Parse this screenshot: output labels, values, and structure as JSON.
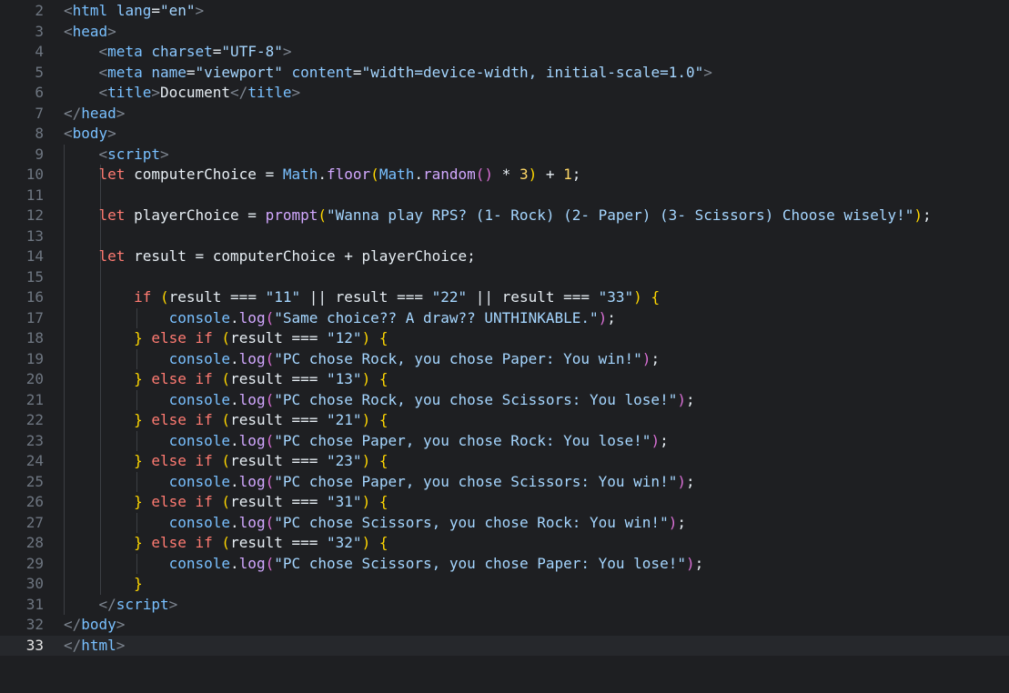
{
  "editor": {
    "current_line": 33,
    "lines": [
      {
        "n": "2",
        "tokens": [
          [
            "punct",
            "<"
          ],
          [
            "tag",
            "html"
          ],
          [
            "txt",
            " "
          ],
          [
            "attr",
            "lang"
          ],
          [
            "op",
            "="
          ],
          [
            "str",
            "\"en\""
          ],
          [
            "punct",
            ">"
          ]
        ]
      },
      {
        "n": "3",
        "tokens": [
          [
            "punct",
            "<"
          ],
          [
            "tag",
            "head"
          ],
          [
            "punct",
            ">"
          ]
        ]
      },
      {
        "n": "4",
        "tokens": [
          [
            "txt",
            "    "
          ],
          [
            "punct",
            "<"
          ],
          [
            "tag",
            "meta"
          ],
          [
            "txt",
            " "
          ],
          [
            "attr",
            "charset"
          ],
          [
            "op",
            "="
          ],
          [
            "str",
            "\"UTF-8\""
          ],
          [
            "punct",
            ">"
          ]
        ]
      },
      {
        "n": "5",
        "tokens": [
          [
            "txt",
            "    "
          ],
          [
            "punct",
            "<"
          ],
          [
            "tag",
            "meta"
          ],
          [
            "txt",
            " "
          ],
          [
            "attr",
            "name"
          ],
          [
            "op",
            "="
          ],
          [
            "str",
            "\"viewport\""
          ],
          [
            "txt",
            " "
          ],
          [
            "attr",
            "content"
          ],
          [
            "op",
            "="
          ],
          [
            "str",
            "\"width=device-width, initial-scale=1.0\""
          ],
          [
            "punct",
            ">"
          ]
        ]
      },
      {
        "n": "6",
        "tokens": [
          [
            "txt",
            "    "
          ],
          [
            "punct",
            "<"
          ],
          [
            "tag",
            "title"
          ],
          [
            "punct",
            ">"
          ],
          [
            "txt",
            "Document"
          ],
          [
            "punct",
            "</"
          ],
          [
            "tag",
            "title"
          ],
          [
            "punct",
            ">"
          ]
        ]
      },
      {
        "n": "7",
        "tokens": [
          [
            "punct",
            "</"
          ],
          [
            "tag",
            "head"
          ],
          [
            "punct",
            ">"
          ]
        ]
      },
      {
        "n": "8",
        "tokens": [
          [
            "punct",
            "<"
          ],
          [
            "tag",
            "body"
          ],
          [
            "punct",
            ">"
          ]
        ]
      },
      {
        "n": "9",
        "tokens": [
          [
            "txt",
            "    "
          ],
          [
            "punct",
            "<"
          ],
          [
            "tag",
            "script"
          ],
          [
            "punct",
            ">"
          ]
        ]
      },
      {
        "n": "10",
        "tokens": [
          [
            "txt",
            "    "
          ],
          [
            "kw",
            "let"
          ],
          [
            "var",
            " computerChoice "
          ],
          [
            "op",
            "= "
          ],
          [
            "obj",
            "Math"
          ],
          [
            "op",
            "."
          ],
          [
            "fn",
            "floor"
          ],
          [
            "b1",
            "("
          ],
          [
            "obj",
            "Math"
          ],
          [
            "op",
            "."
          ],
          [
            "fn",
            "random"
          ],
          [
            "b2",
            "()"
          ],
          [
            "op",
            " * "
          ],
          [
            "num",
            "3"
          ],
          [
            "b1",
            ")"
          ],
          [
            "op",
            " + "
          ],
          [
            "num",
            "1"
          ],
          [
            "op",
            ";"
          ]
        ]
      },
      {
        "n": "11",
        "tokens": []
      },
      {
        "n": "12",
        "tokens": [
          [
            "txt",
            "    "
          ],
          [
            "kw",
            "let"
          ],
          [
            "var",
            " playerChoice "
          ],
          [
            "op",
            "= "
          ],
          [
            "fn",
            "prompt"
          ],
          [
            "b1",
            "("
          ],
          [
            "str",
            "\"Wanna play RPS? (1- Rock) (2- Paper) (3- Scissors) Choose wisely!\""
          ],
          [
            "b1",
            ")"
          ],
          [
            "op",
            ";"
          ]
        ]
      },
      {
        "n": "13",
        "tokens": []
      },
      {
        "n": "14",
        "tokens": [
          [
            "txt",
            "    "
          ],
          [
            "kw",
            "let"
          ],
          [
            "var",
            " result "
          ],
          [
            "op",
            "= "
          ],
          [
            "var",
            "computerChoice "
          ],
          [
            "op",
            "+ "
          ],
          [
            "var",
            "playerChoice"
          ],
          [
            "op",
            ";"
          ]
        ]
      },
      {
        "n": "15",
        "tokens": []
      },
      {
        "n": "16",
        "tokens": [
          [
            "txt",
            "        "
          ],
          [
            "kw",
            "if"
          ],
          [
            "txt",
            " "
          ],
          [
            "b1",
            "("
          ],
          [
            "var",
            "result "
          ],
          [
            "op",
            "=== "
          ],
          [
            "str",
            "\"11\""
          ],
          [
            "op",
            " || "
          ],
          [
            "var",
            "result "
          ],
          [
            "op",
            "=== "
          ],
          [
            "str",
            "\"22\""
          ],
          [
            "op",
            " || "
          ],
          [
            "var",
            "result "
          ],
          [
            "op",
            "=== "
          ],
          [
            "str",
            "\"33\""
          ],
          [
            "b1",
            ")"
          ],
          [
            "txt",
            " "
          ],
          [
            "b1",
            "{"
          ]
        ]
      },
      {
        "n": "17",
        "tokens": [
          [
            "txt",
            "            "
          ],
          [
            "obj",
            "console"
          ],
          [
            "op",
            "."
          ],
          [
            "fn",
            "log"
          ],
          [
            "b2",
            "("
          ],
          [
            "str",
            "\"Same choice?? A draw?? UNTHINKABLE.\""
          ],
          [
            "b2",
            ")"
          ],
          [
            "op",
            ";"
          ]
        ]
      },
      {
        "n": "18",
        "tokens": [
          [
            "txt",
            "        "
          ],
          [
            "b1",
            "}"
          ],
          [
            "txt",
            " "
          ],
          [
            "kw",
            "else if"
          ],
          [
            "txt",
            " "
          ],
          [
            "b1",
            "("
          ],
          [
            "var",
            "result "
          ],
          [
            "op",
            "=== "
          ],
          [
            "str",
            "\"12\""
          ],
          [
            "b1",
            ")"
          ],
          [
            "txt",
            " "
          ],
          [
            "b1",
            "{"
          ]
        ]
      },
      {
        "n": "19",
        "tokens": [
          [
            "txt",
            "            "
          ],
          [
            "obj",
            "console"
          ],
          [
            "op",
            "."
          ],
          [
            "fn",
            "log"
          ],
          [
            "b2",
            "("
          ],
          [
            "str",
            "\"PC chose Rock, you chose Paper: You win!\""
          ],
          [
            "b2",
            ")"
          ],
          [
            "op",
            ";"
          ]
        ]
      },
      {
        "n": "20",
        "tokens": [
          [
            "txt",
            "        "
          ],
          [
            "b1",
            "}"
          ],
          [
            "txt",
            " "
          ],
          [
            "kw",
            "else if"
          ],
          [
            "txt",
            " "
          ],
          [
            "b1",
            "("
          ],
          [
            "var",
            "result "
          ],
          [
            "op",
            "=== "
          ],
          [
            "str",
            "\"13\""
          ],
          [
            "b1",
            ")"
          ],
          [
            "txt",
            " "
          ],
          [
            "b1",
            "{"
          ]
        ]
      },
      {
        "n": "21",
        "tokens": [
          [
            "txt",
            "            "
          ],
          [
            "obj",
            "console"
          ],
          [
            "op",
            "."
          ],
          [
            "fn",
            "log"
          ],
          [
            "b2",
            "("
          ],
          [
            "str",
            "\"PC chose Rock, you chose Scissors: You lose!\""
          ],
          [
            "b2",
            ")"
          ],
          [
            "op",
            ";"
          ]
        ]
      },
      {
        "n": "22",
        "tokens": [
          [
            "txt",
            "        "
          ],
          [
            "b1",
            "}"
          ],
          [
            "txt",
            " "
          ],
          [
            "kw",
            "else if"
          ],
          [
            "txt",
            " "
          ],
          [
            "b1",
            "("
          ],
          [
            "var",
            "result "
          ],
          [
            "op",
            "=== "
          ],
          [
            "str",
            "\"21\""
          ],
          [
            "b1",
            ")"
          ],
          [
            "txt",
            " "
          ],
          [
            "b1",
            "{"
          ]
        ]
      },
      {
        "n": "23",
        "tokens": [
          [
            "txt",
            "            "
          ],
          [
            "obj",
            "console"
          ],
          [
            "op",
            "."
          ],
          [
            "fn",
            "log"
          ],
          [
            "b2",
            "("
          ],
          [
            "str",
            "\"PC chose Paper, you chose Rock: You lose!\""
          ],
          [
            "b2",
            ")"
          ],
          [
            "op",
            ";"
          ]
        ]
      },
      {
        "n": "24",
        "tokens": [
          [
            "txt",
            "        "
          ],
          [
            "b1",
            "}"
          ],
          [
            "txt",
            " "
          ],
          [
            "kw",
            "else if"
          ],
          [
            "txt",
            " "
          ],
          [
            "b1",
            "("
          ],
          [
            "var",
            "result "
          ],
          [
            "op",
            "=== "
          ],
          [
            "str",
            "\"23\""
          ],
          [
            "b1",
            ")"
          ],
          [
            "txt",
            " "
          ],
          [
            "b1",
            "{"
          ]
        ]
      },
      {
        "n": "25",
        "tokens": [
          [
            "txt",
            "            "
          ],
          [
            "obj",
            "console"
          ],
          [
            "op",
            "."
          ],
          [
            "fn",
            "log"
          ],
          [
            "b2",
            "("
          ],
          [
            "str",
            "\"PC chose Paper, you chose Scissors: You win!\""
          ],
          [
            "b2",
            ")"
          ],
          [
            "op",
            ";"
          ]
        ]
      },
      {
        "n": "26",
        "tokens": [
          [
            "txt",
            "        "
          ],
          [
            "b1",
            "}"
          ],
          [
            "txt",
            " "
          ],
          [
            "kw",
            "else if"
          ],
          [
            "txt",
            " "
          ],
          [
            "b1",
            "("
          ],
          [
            "var",
            "result "
          ],
          [
            "op",
            "=== "
          ],
          [
            "str",
            "\"31\""
          ],
          [
            "b1",
            ")"
          ],
          [
            "txt",
            " "
          ],
          [
            "b1",
            "{"
          ]
        ]
      },
      {
        "n": "27",
        "tokens": [
          [
            "txt",
            "            "
          ],
          [
            "obj",
            "console"
          ],
          [
            "op",
            "."
          ],
          [
            "fn",
            "log"
          ],
          [
            "b2",
            "("
          ],
          [
            "str",
            "\"PC chose Scissors, you chose Rock: You win!\""
          ],
          [
            "b2",
            ")"
          ],
          [
            "op",
            ";"
          ]
        ]
      },
      {
        "n": "28",
        "tokens": [
          [
            "txt",
            "        "
          ],
          [
            "b1",
            "}"
          ],
          [
            "txt",
            " "
          ],
          [
            "kw",
            "else if"
          ],
          [
            "txt",
            " "
          ],
          [
            "b1",
            "("
          ],
          [
            "var",
            "result "
          ],
          [
            "op",
            "=== "
          ],
          [
            "str",
            "\"32\""
          ],
          [
            "b1",
            ")"
          ],
          [
            "txt",
            " "
          ],
          [
            "b1",
            "{"
          ]
        ]
      },
      {
        "n": "29",
        "tokens": [
          [
            "txt",
            "            "
          ],
          [
            "obj",
            "console"
          ],
          [
            "op",
            "."
          ],
          [
            "fn",
            "log"
          ],
          [
            "b2",
            "("
          ],
          [
            "str",
            "\"PC chose Scissors, you chose Paper: You lose!\""
          ],
          [
            "b2",
            ")"
          ],
          [
            "op",
            ";"
          ]
        ]
      },
      {
        "n": "30",
        "tokens": [
          [
            "txt",
            "        "
          ],
          [
            "b1",
            "}"
          ]
        ]
      },
      {
        "n": "31",
        "tokens": [
          [
            "txt",
            "    "
          ],
          [
            "punct",
            "</"
          ],
          [
            "tag",
            "script"
          ],
          [
            "punct",
            ">"
          ]
        ]
      },
      {
        "n": "32",
        "tokens": [
          [
            "punct",
            "</"
          ],
          [
            "tag",
            "body"
          ],
          [
            "punct",
            ">"
          ]
        ]
      },
      {
        "n": "33",
        "tokens": [
          [
            "punct",
            "</"
          ],
          [
            "tag",
            "html"
          ],
          [
            "punct",
            ">"
          ]
        ]
      }
    ]
  }
}
